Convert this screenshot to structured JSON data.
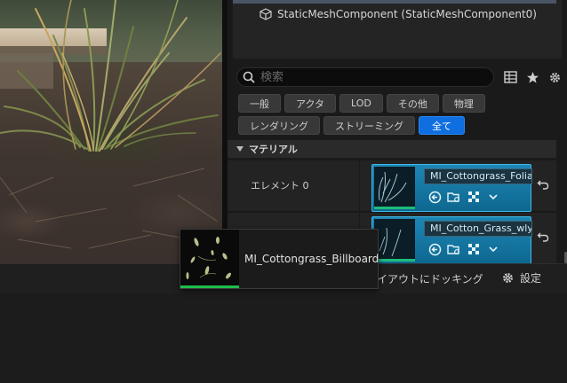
{
  "component": {
    "label": "StaticMeshComponent (StaticMeshComponent0)",
    "icon": "cube-icon"
  },
  "search": {
    "placeholder": "検索"
  },
  "toolbar_icons": [
    "table-icon",
    "star-icon",
    "gear-icon"
  ],
  "filters": {
    "row1": [
      "一般",
      "アクタ",
      "LOD",
      "その他",
      "物理"
    ],
    "row2": [
      "レンダリング",
      "ストリーミング",
      "全て"
    ],
    "active": "全て"
  },
  "category": {
    "title": "マテリアル"
  },
  "elements": [
    {
      "label": "エレメント 0",
      "material": "MI_Cottongrass_Foliage"
    },
    {
      "label": "",
      "material": "MI_Cotton_Grass_wlyke"
    }
  ],
  "bottom": {
    "dock_label": "イアウトにドッキング",
    "settings_label": "設定"
  },
  "drag": {
    "material": "MI_Cottongrass_Billboard"
  },
  "colors": {
    "accent": "#0f6fe0",
    "slot": "#1d86b5",
    "thumb_bar": "#1ebd4a"
  }
}
